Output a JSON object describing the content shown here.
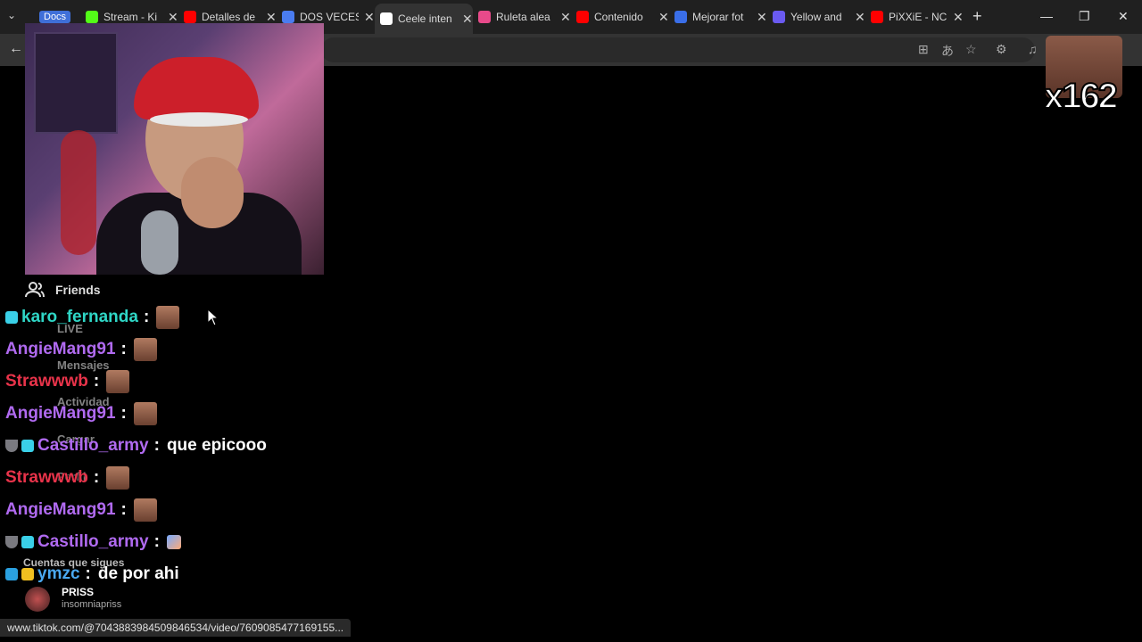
{
  "browser": {
    "docs_label": "Docs",
    "tabs": [
      {
        "title": "Stream - Ki",
        "color": "#53fc18"
      },
      {
        "title": "Detalles de",
        "color": "#ff0000"
      },
      {
        "title": "DOS VECES",
        "color": "#4a7cf0"
      },
      {
        "title": "Ceele inten",
        "color": "#ffffff",
        "active": true
      },
      {
        "title": "Ruleta alea",
        "color": "#e84a8a"
      },
      {
        "title": "Contenido",
        "color": "#ff0000"
      },
      {
        "title": "Mejorar fot",
        "color": "#3a6ee8"
      },
      {
        "title": "Yellow and",
        "color": "#6a5af0"
      },
      {
        "title": "PiXXiE - NC",
        "color": "#ff0000"
      }
    ],
    "status_url": "www.tiktok.com/@7043883984509846534/video/7609085477169155..."
  },
  "overlay": {
    "emote_count": "x162"
  },
  "sidebar": {
    "friends_label": "Friends",
    "ghost_items": [
      "LIVE",
      "Mensajes",
      "Actividad",
      "Cargar",
      "Perfil"
    ],
    "suggested_label": "Cuentas que sigues",
    "suggested_account": {
      "name": "PRISS",
      "handle": "insomniapriss"
    }
  },
  "chat": [
    {
      "user": "karo_fernanda",
      "color": "#2fd6c6",
      "badges": [
        "sub"
      ],
      "message": "",
      "emote": true
    },
    {
      "user": "AngieMang91",
      "color": "#b06af0",
      "badges": [],
      "message": "",
      "emote": true
    },
    {
      "user": "Strawwwb",
      "color": "#e8334a",
      "badges": [],
      "message": "",
      "emote": true
    },
    {
      "user": "AngieMang91",
      "color": "#b06af0",
      "badges": [],
      "message": "",
      "emote": true
    },
    {
      "user": "Castillo_army",
      "color": "#b06af0",
      "badges": [
        "shield",
        "sub"
      ],
      "message": "que epicooo",
      "emote": false
    },
    {
      "user": "Strawwwb",
      "color": "#e8334a",
      "badges": [],
      "message": "",
      "emote": true
    },
    {
      "user": "AngieMang91",
      "color": "#b06af0",
      "badges": [],
      "message": "",
      "emote": true
    },
    {
      "user": "Castillo_army",
      "color": "#b06af0",
      "badges": [
        "shield",
        "sub"
      ],
      "message": "",
      "emote": false,
      "small_emote": true
    },
    {
      "user": "ymzc",
      "color": "#4aa8f0",
      "badges": [
        "cube",
        "crown"
      ],
      "message": "de por ahi",
      "emote": false
    }
  ]
}
